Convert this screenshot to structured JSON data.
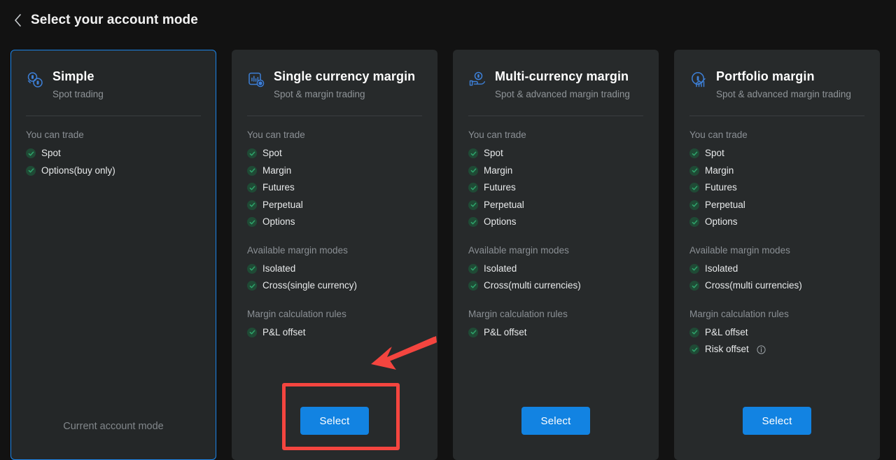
{
  "header": {
    "back_icon": "chevron-left-icon",
    "title": "Select your account mode"
  },
  "colors": {
    "page_background": "#121212",
    "card_background": "#272a2b",
    "selected_card_border": "#1b84e8",
    "primary_button": "#1283e2",
    "check_green": "#2fa36b",
    "annotation_red": "#f4453f",
    "icon_blue": "#3d7fd6",
    "muted_text": "#8b9095"
  },
  "annotations": {
    "highlight_target": "single-currency-margin-select-button",
    "arrow": "red-arrow-pointing-to-select-button"
  },
  "cards": [
    {
      "id": "simple",
      "icon": "two-coins-icon",
      "title": "Simple",
      "subtitle": "Spot trading",
      "selected": true,
      "sections": [
        {
          "label": "You can trade",
          "items": [
            {
              "label": "Spot",
              "info": false
            },
            {
              "label": "Options(buy only)",
              "info": false
            }
          ]
        }
      ],
      "footer_type": "current",
      "footer_text": "Current account mode"
    },
    {
      "id": "single-currency-margin",
      "icon": "chart-coin-icon",
      "title": "Single currency margin",
      "subtitle": "Spot & margin trading",
      "selected": false,
      "sections": [
        {
          "label": "You can trade",
          "items": [
            {
              "label": "Spot",
              "info": false
            },
            {
              "label": "Margin",
              "info": false
            },
            {
              "label": "Futures",
              "info": false
            },
            {
              "label": "Perpetual",
              "info": false
            },
            {
              "label": "Options",
              "info": false
            }
          ]
        },
        {
          "label": "Available margin modes",
          "items": [
            {
              "label": "Isolated",
              "info": false
            },
            {
              "label": "Cross(single currency)",
              "info": false
            }
          ]
        },
        {
          "label": "Margin calculation rules",
          "items": [
            {
              "label": "P&L offset",
              "info": false
            }
          ]
        }
      ],
      "footer_type": "button",
      "footer_text": "Select"
    },
    {
      "id": "multi-currency-margin",
      "icon": "hand-coin-icon",
      "title": "Multi-currency margin",
      "subtitle": "Spot & advanced margin trading",
      "selected": false,
      "sections": [
        {
          "label": "You can trade",
          "items": [
            {
              "label": "Spot",
              "info": false
            },
            {
              "label": "Margin",
              "info": false
            },
            {
              "label": "Futures",
              "info": false
            },
            {
              "label": "Perpetual",
              "info": false
            },
            {
              "label": "Options",
              "info": false
            }
          ]
        },
        {
          "label": "Available margin modes",
          "items": [
            {
              "label": "Isolated",
              "info": false
            },
            {
              "label": "Cross(multi currencies)",
              "info": false
            }
          ]
        },
        {
          "label": "Margin calculation rules",
          "items": [
            {
              "label": "P&L offset",
              "info": false
            }
          ]
        }
      ],
      "footer_type": "button",
      "footer_text": "Select"
    },
    {
      "id": "portfolio-margin",
      "icon": "coin-trend-icon",
      "title": "Portfolio margin",
      "subtitle": "Spot & advanced margin trading",
      "selected": false,
      "sections": [
        {
          "label": "You can trade",
          "items": [
            {
              "label": "Spot",
              "info": false
            },
            {
              "label": "Margin",
              "info": false
            },
            {
              "label": "Futures",
              "info": false
            },
            {
              "label": "Perpetual",
              "info": false
            },
            {
              "label": "Options",
              "info": false
            }
          ]
        },
        {
          "label": "Available margin modes",
          "items": [
            {
              "label": "Isolated",
              "info": false
            },
            {
              "label": "Cross(multi currencies)",
              "info": false
            }
          ]
        },
        {
          "label": "Margin calculation rules",
          "items": [
            {
              "label": "P&L offset",
              "info": false
            },
            {
              "label": "Risk offset",
              "info": true
            }
          ]
        }
      ],
      "footer_type": "button",
      "footer_text": "Select"
    }
  ]
}
